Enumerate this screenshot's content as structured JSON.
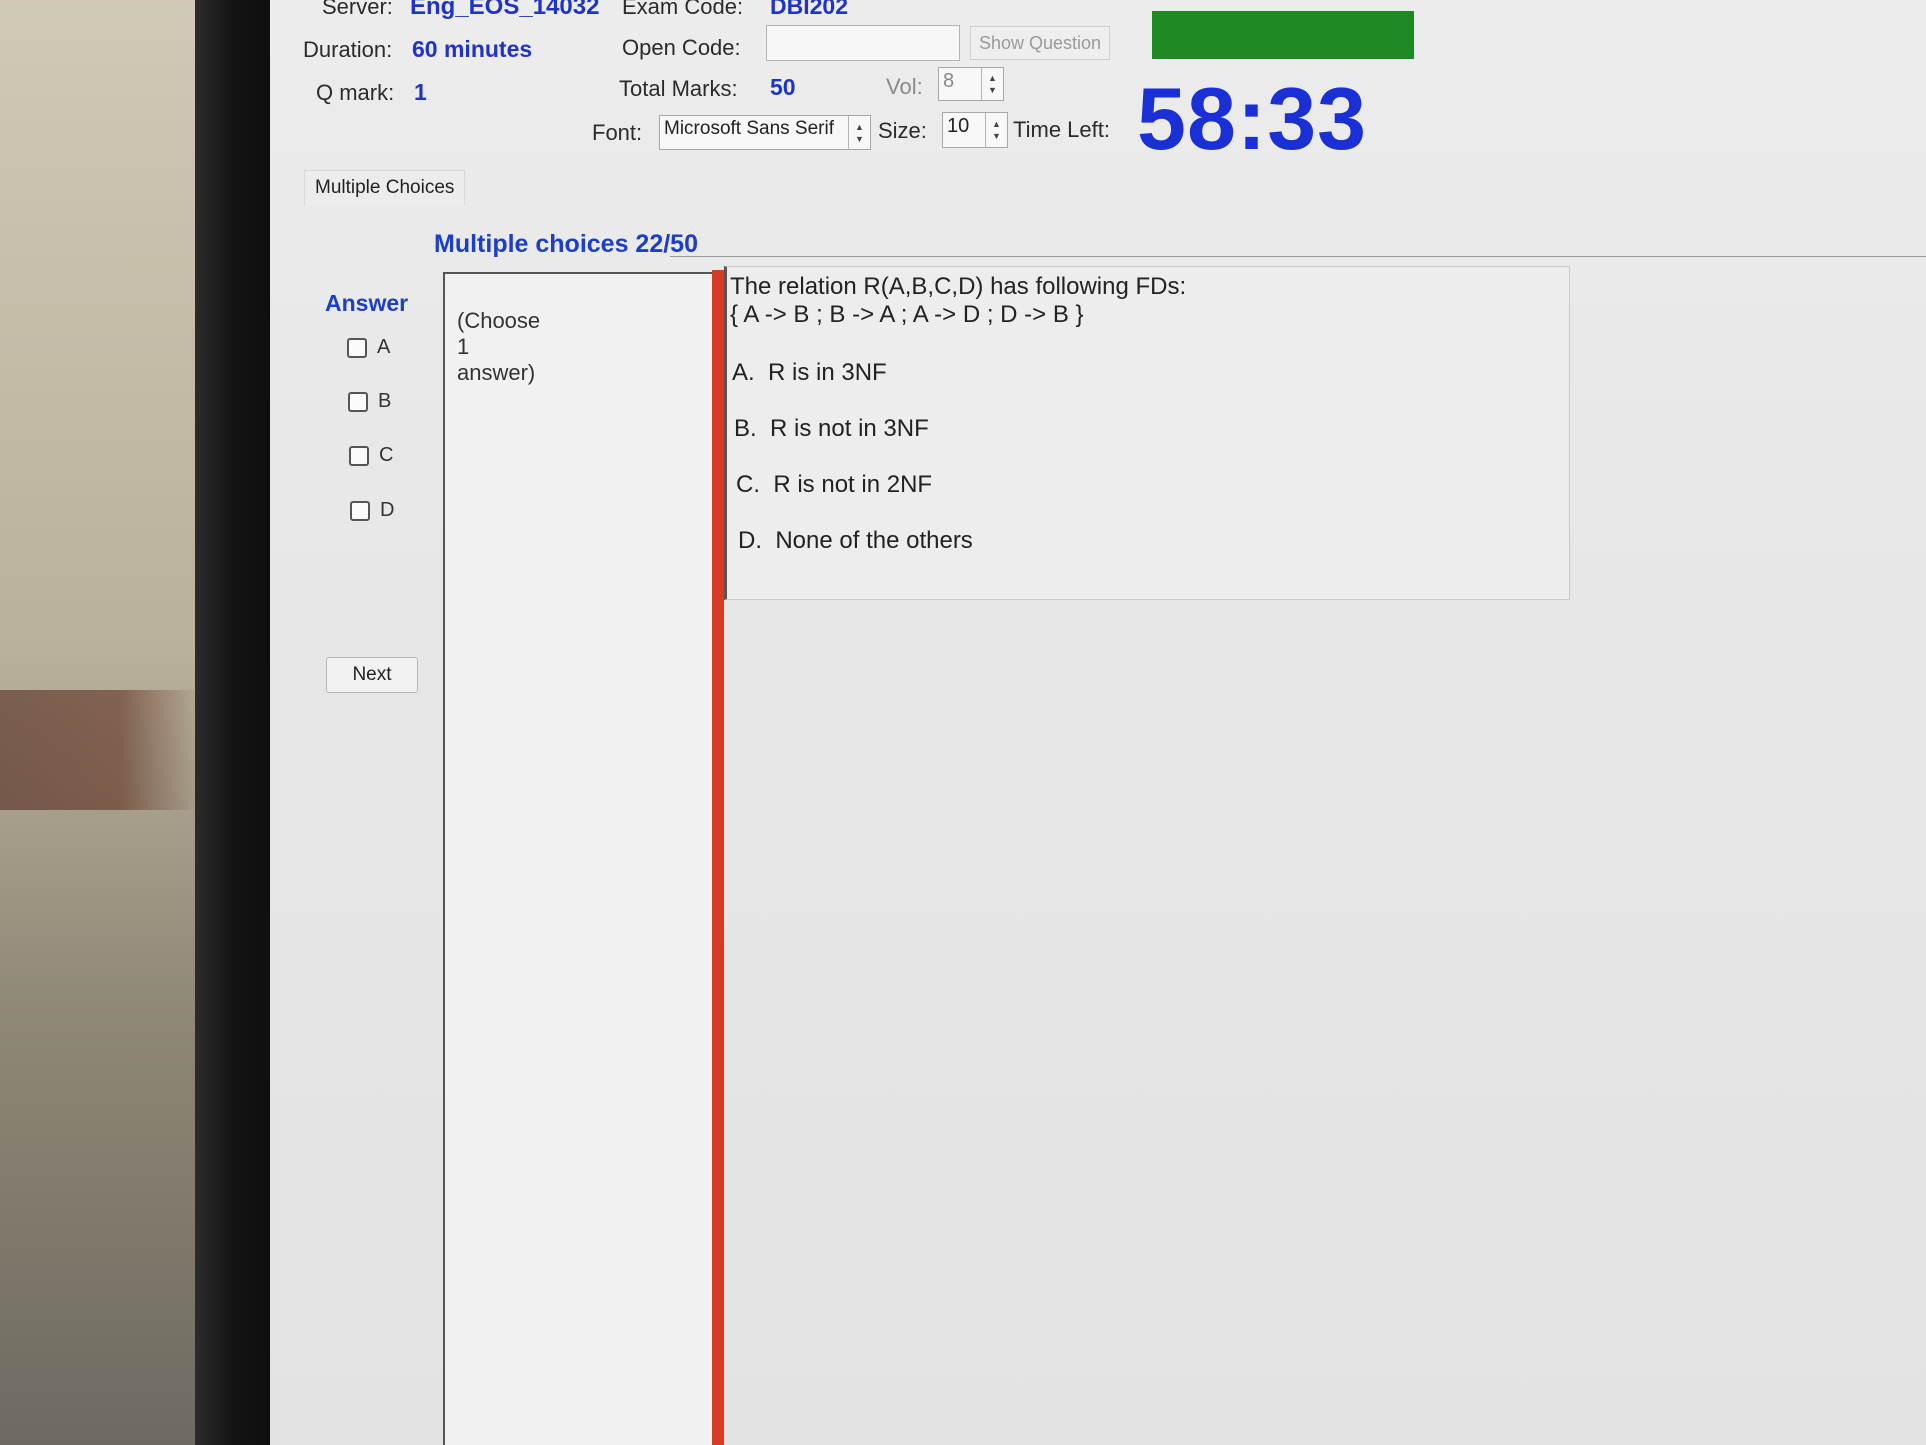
{
  "header": {
    "server_label": "Server:",
    "server_value": "Eng_EOS_14032",
    "exam_code_label": "Exam Code:",
    "exam_code_value": "DBI202",
    "duration_label": "Duration:",
    "duration_value": "60 minutes",
    "open_code_label": "Open Code:",
    "open_code_value": "",
    "show_question_label": "Show Question",
    "q_mark_label": "Q mark:",
    "q_mark_value": "1",
    "total_marks_label": "Total Marks:",
    "total_marks_value": "50",
    "vol_label": "Vol:",
    "vol_value": "8",
    "font_label": "Font:",
    "font_value": "Microsoft Sans Serif",
    "size_label": "Size:",
    "size_value": "10",
    "time_left_label": "Time Left:",
    "time_left_value": "58:33",
    "status_color": "#1e8a24"
  },
  "tabs": {
    "active_label": "Multiple Choices"
  },
  "question": {
    "progress_title": "Multiple choices 22/50",
    "answer_heading": "Answer",
    "options": [
      {
        "key": "A",
        "checked": false
      },
      {
        "key": "B",
        "checked": false
      },
      {
        "key": "C",
        "checked": false
      },
      {
        "key": "D",
        "checked": false
      }
    ],
    "next_label": "Next",
    "hint_text": "(Choose\n1\nanswer)",
    "stem_line1": "The relation R(A,B,C,D) has following FDs:",
    "stem_line2": "{ A -> B ; B -> A ; A -> D ; D -> B }",
    "choices": [
      {
        "letter": "A.",
        "text": "R is in 3NF"
      },
      {
        "letter": "B.",
        "text": "R is not in 3NF"
      },
      {
        "letter": "C.",
        "text": "R is not in 2NF"
      },
      {
        "letter": "D.",
        "text": "None of the others"
      }
    ]
  },
  "colors": {
    "accent_blue": "#1f33c9",
    "divider_red": "#d83a25"
  }
}
